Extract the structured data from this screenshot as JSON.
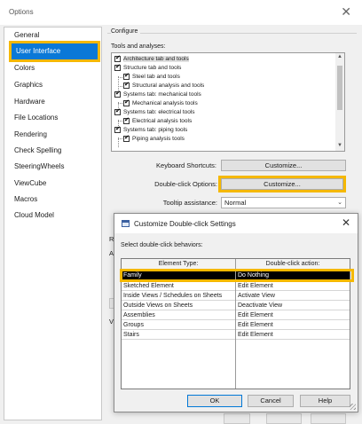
{
  "window": {
    "title": "Options",
    "close_glyph": "✕"
  },
  "nav": {
    "items": [
      {
        "label": "General"
      },
      {
        "label": "User Interface",
        "selected": true
      },
      {
        "label": "Colors"
      },
      {
        "label": "Graphics"
      },
      {
        "label": "Hardware"
      },
      {
        "label": "File Locations"
      },
      {
        "label": "Rendering"
      },
      {
        "label": "Check Spelling"
      },
      {
        "label": "SteeringWheels"
      },
      {
        "label": "ViewCube"
      },
      {
        "label": "Macros"
      },
      {
        "label": "Cloud Model"
      }
    ]
  },
  "configure": {
    "group_label": "Configure",
    "tools_label": "Tools and analyses:",
    "tree": [
      {
        "label": "Architecture tab and tools",
        "checked": true,
        "highlight": true
      },
      {
        "label": "Structure tab and tools",
        "checked": true
      },
      {
        "label": "Steel tab and tools",
        "checked": true
      },
      {
        "label": "Structural analysis and tools",
        "checked": true
      },
      {
        "label": "Systems tab: mechanical tools",
        "checked": true
      },
      {
        "label": "Mechanical analysis tools",
        "checked": true
      },
      {
        "label": "Systems tab: electrical tools",
        "checked": true
      },
      {
        "label": "Electrical analysis tools",
        "checked": true
      },
      {
        "label": "Systems tab: piping tools",
        "checked": true
      },
      {
        "label": "Piping analysis tools",
        "checked": true
      }
    ],
    "keyboard_label": "Keyboard Shortcuts:",
    "keyboard_button": "Customize...",
    "doubleclick_label": "Double-click Options:",
    "doubleclick_button": "Customize...",
    "tooltip_label": "Tooltip assistance:",
    "tooltip_value": "Normal",
    "partial_letters": [
      "R",
      "A",
      "V"
    ]
  },
  "dialog": {
    "title": "Customize Double-click Settings",
    "close_glyph": "✕",
    "instruction": "Select double-click behaviors:",
    "columns": [
      "Element Type:",
      "Double-click action:"
    ],
    "rows": [
      {
        "type": "Family",
        "action": "Do Nothing",
        "selected": true
      },
      {
        "type": "Sketched Element",
        "action": "Edit Element"
      },
      {
        "type": "Inside Views / Schedules on Sheets",
        "action": "Activate View"
      },
      {
        "type": "Outside Views on Sheets",
        "action": "Deactivate View"
      },
      {
        "type": "Assemblies",
        "action": "Edit Element"
      },
      {
        "type": "Groups",
        "action": "Edit Element"
      },
      {
        "type": "Stairs",
        "action": "Edit Element"
      }
    ],
    "buttons": {
      "ok": "OK",
      "cancel": "Cancel",
      "help": "Help"
    }
  },
  "colors": {
    "accent": "#0a78d7",
    "highlight": "#f5b800",
    "selected_row": "#000000"
  }
}
